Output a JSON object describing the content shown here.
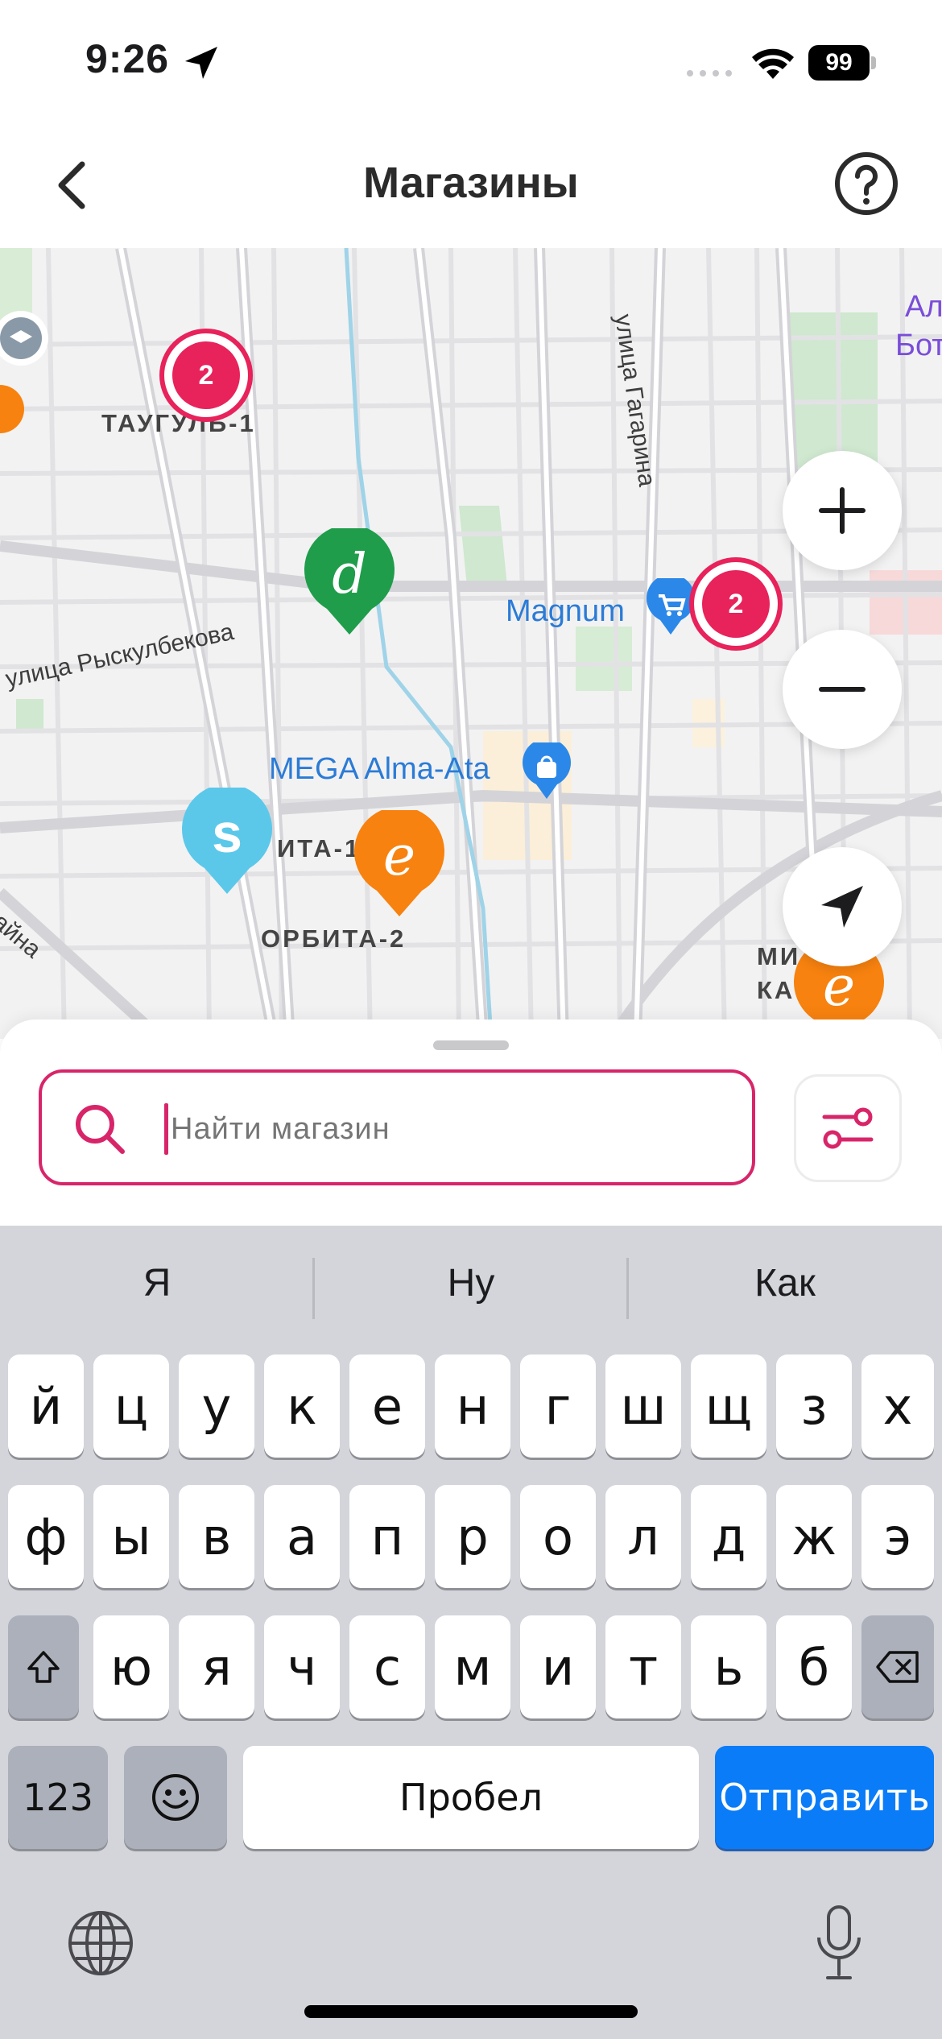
{
  "status_bar": {
    "time": "9:26",
    "battery": "99",
    "icons": [
      "location-arrow-icon",
      "signal-icon",
      "wifi-icon",
      "battery-icon"
    ]
  },
  "header": {
    "title": "Магазины",
    "back_icon": "chevron-left-icon",
    "help_icon": "question-circle-icon"
  },
  "map": {
    "labels": {
      "street_rysk": "улица Рыскулбекова",
      "street_gagarin": "улица Гагарина",
      "taugul": "ТАУГУЛЬ-1",
      "orbita1": "ИТА-1",
      "orbita2": "ОРБИТА-2",
      "magnum": "Magnum",
      "mega": "MEGA Alma-Ata",
      "edge_top": "Ал",
      "edge_top2": "Бот",
      "bottom_right1": "МИ     АЙС",
      "bottom_right2": "КА       ИЛЬ",
      "corner_left": "айна"
    },
    "clusters": [
      {
        "count": "2"
      },
      {
        "count": "2"
      }
    ],
    "pins": [
      {
        "letter": "d",
        "color": "#1f9d4a"
      },
      {
        "letter": "s",
        "color": "#5bc8ea"
      },
      {
        "letter": "e",
        "color": "#f7820f"
      },
      {
        "letter": "e",
        "color": "#f7820f"
      }
    ],
    "controls": {
      "zoom_in": "+",
      "zoom_out": "−"
    }
  },
  "search": {
    "placeholder": "Найти магазин",
    "value": ""
  },
  "keyboard": {
    "suggestions": [
      "Я",
      "Ну",
      "Как"
    ],
    "row1": [
      "й",
      "ц",
      "у",
      "к",
      "е",
      "н",
      "г",
      "ш",
      "щ",
      "з",
      "х"
    ],
    "row2": [
      "ф",
      "ы",
      "в",
      "а",
      "п",
      "р",
      "о",
      "л",
      "д",
      "ж",
      "э"
    ],
    "row3": [
      "я",
      "ч",
      "с",
      "м",
      "и",
      "т",
      "ь",
      "б",
      "ю"
    ],
    "numbers_key": "123",
    "space_key": "Пробел",
    "send_key": "Отправить"
  },
  "colors": {
    "accent": "#d8256a",
    "cluster": "#e8225a",
    "send_key": "#0a7cf8"
  }
}
